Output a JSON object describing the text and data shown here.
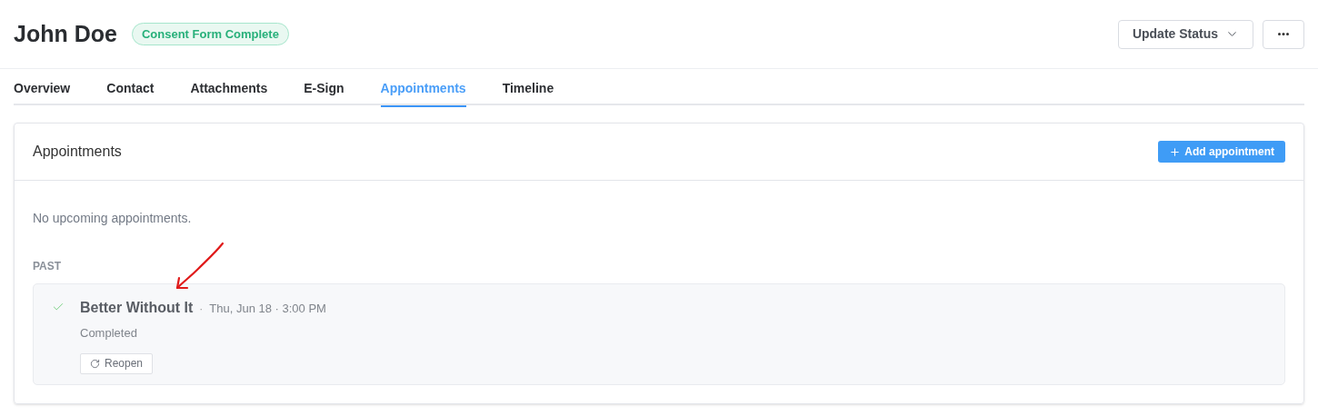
{
  "header": {
    "name": "John Doe",
    "badge": "Consent Form Complete",
    "status_button": "Update Status"
  },
  "tabs": [
    {
      "label": "Overview",
      "selected": false
    },
    {
      "label": "Contact",
      "selected": false
    },
    {
      "label": "Attachments",
      "selected": false
    },
    {
      "label": "E-Sign",
      "selected": false
    },
    {
      "label": "Appointments",
      "selected": true
    },
    {
      "label": "Timeline",
      "selected": false
    }
  ],
  "card": {
    "title": "Appointments",
    "add_button": "Add appointment",
    "empty_text": "No upcoming appointments.",
    "section_label": "PAST",
    "appointments": [
      {
        "title": "Better Without It",
        "separator": "·",
        "when": "Thu, Jun 18 · 3:00 PM",
        "status": "Completed",
        "done": true,
        "action": "Reopen"
      }
    ]
  }
}
